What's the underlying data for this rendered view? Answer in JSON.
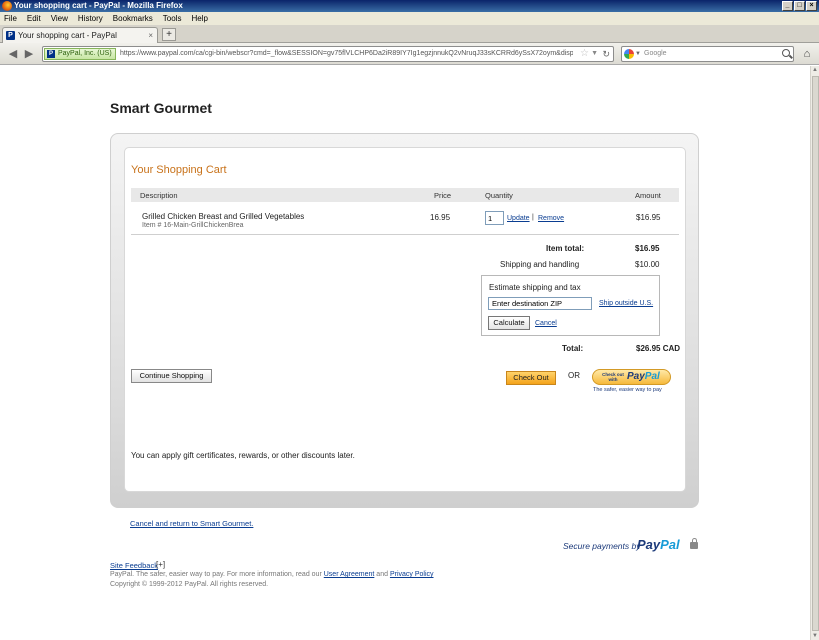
{
  "window": {
    "title": "Your shopping cart - PayPal - Mozilla Firefox",
    "buttons": [
      "_",
      "□",
      "×"
    ]
  },
  "menu": [
    "File",
    "Edit",
    "View",
    "History",
    "Bookmarks",
    "Tools",
    "Help"
  ],
  "tab": {
    "title": "Your shopping cart - PayPal",
    "favicon": "P",
    "close": "×",
    "new_tab": "+"
  },
  "nav": {
    "identity": "PayPal, Inc. (US)",
    "url": "https://www.paypal.com/ca/cgi-bin/webscr?cmd=_flow&SESSION=gv75flVLCHP6Da2iR89IY7Ig1egzjnnukQ2vNruqJ33sKCRRd6ySsX72oym&dispatch=",
    "search_placeholder": "Google",
    "back": "◀",
    "forward": "▶",
    "home": "⌂",
    "reload": "↻",
    "star": "☆",
    "dropdown": "▼"
  },
  "page": {
    "merchant": "Smart Gourmet",
    "cart_title": "Your Shopping Cart",
    "columns": {
      "description": "Description",
      "price": "Price",
      "quantity": "Quantity",
      "amount": "Amount"
    },
    "item": {
      "name": "Grilled Chicken Breast and Grilled Vegetables",
      "number": "Item # 16-Main-GrillChickenBrea",
      "price": "16.95",
      "quantity": "1",
      "update": "Update",
      "separator": "|",
      "remove": "Remove",
      "amount": "$16.95"
    },
    "item_total_label": "Item total:",
    "item_total": "$16.95",
    "shipping_label": "Shipping and handling",
    "shipping": "$10.00",
    "estimate": {
      "title": "Estimate shipping and tax",
      "zip_value": "Enter destination ZIP",
      "ship_outside": "Ship outside U.S.",
      "calculate": "Calculate",
      "cancel": "Cancel"
    },
    "total_label": "Total:",
    "total": "$26.95 CAD",
    "continue": "Continue Shopping",
    "checkout": "Check Out",
    "or": "OR",
    "paypal_button": {
      "small": "Check out with",
      "brand_a": "Pay",
      "brand_b": "Pal",
      "tagline": "The safer, easier way to pay"
    },
    "gift_note": "You can apply gift certificates, rewards, or other discounts later.",
    "cancel_return": "Cancel and return to Smart Gourmet.",
    "secure": {
      "text": "Secure payments by",
      "brand_a": "Pay",
      "brand_b": "Pal"
    }
  },
  "footer": {
    "feedback": "Site Feedback",
    "feedback_icon": "[+]",
    "line_prefix": "PayPal. The safer, easier way to pay. For more information, read our",
    "user_agreement": "User Agreement",
    "and": "and",
    "privacy": "Privacy Policy",
    "copyright": "Copyright © 1999-2012 PayPal. All rights reserved."
  }
}
